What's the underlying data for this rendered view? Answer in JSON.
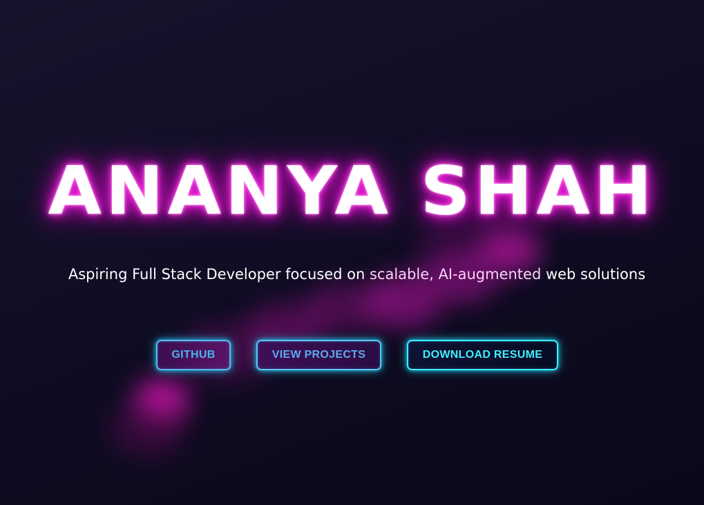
{
  "hero": {
    "name": "ANANYA SHAH",
    "tagline_prefix": "Aspiring Full Stack Developer focused on ",
    "tagline_highlight": "scalable, AI-augmented",
    "tagline_suffix": " web solutions"
  },
  "buttons": {
    "github": "GITHUB",
    "projects": "VIEW PROJECTS",
    "resume": "DOWNLOAD RESUME"
  },
  "colors": {
    "background": "#120f28",
    "title_glow": "#e815d6",
    "button_border": "#45e6ff",
    "button_text": "#3eeeff"
  }
}
